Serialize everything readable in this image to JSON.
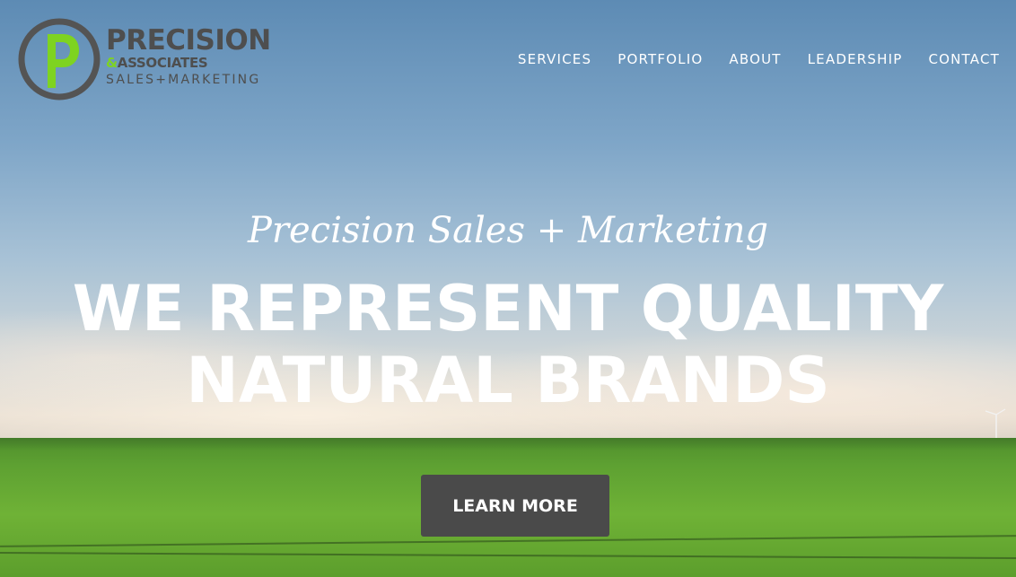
{
  "brand": {
    "name_line1": "PRECISION",
    "name_line2_amp": "&",
    "name_line2": "ASSOCIATES",
    "name_line3": "SALES+MARKETING",
    "mark_letter": "P",
    "colors": {
      "mark_ring": "#545454",
      "mark_letter": "#7ed321",
      "text": "#4e4e4e"
    }
  },
  "nav": {
    "items": [
      {
        "label": "SERVICES"
      },
      {
        "label": "PORTFOLIO"
      },
      {
        "label": "ABOUT"
      },
      {
        "label": "LEADERSHIP"
      },
      {
        "label": "CONTACT"
      }
    ]
  },
  "hero": {
    "tagline": "Precision Sales + Marketing",
    "headline_line1": "WE REPRESENT QUALITY",
    "headline_line2": "NATURAL BRANDS",
    "cta_label": "LEARN MORE",
    "colors": {
      "cta_bg": "#4a4a4a",
      "text": "#ffffff"
    }
  }
}
